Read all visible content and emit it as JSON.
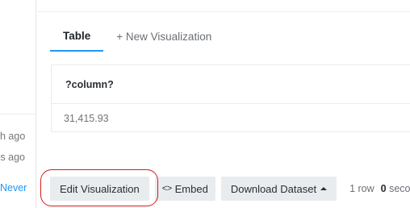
{
  "sidebar": {
    "items": [
      {
        "text": "h ago"
      },
      {
        "text": "s ago"
      },
      {
        "text": "Never"
      }
    ]
  },
  "tabs": [
    {
      "label": "Table",
      "active": true
    },
    {
      "label": "+ New Visualization",
      "active": false
    }
  ],
  "table": {
    "columns": [
      "?column?"
    ],
    "rows": [
      [
        "31,415.93"
      ]
    ]
  },
  "toolbar": {
    "edit_label": "Edit Visualization",
    "embed_icon": "<>",
    "embed_label": "Embed",
    "download_label": "Download Dataset",
    "rows_count": "1",
    "rows_label": "row",
    "secs_value": "0",
    "secs_label": "seco"
  },
  "colors": {
    "accent": "#2196f3",
    "highlight": "#d81b1b",
    "button_bg": "#e9ecef"
  }
}
